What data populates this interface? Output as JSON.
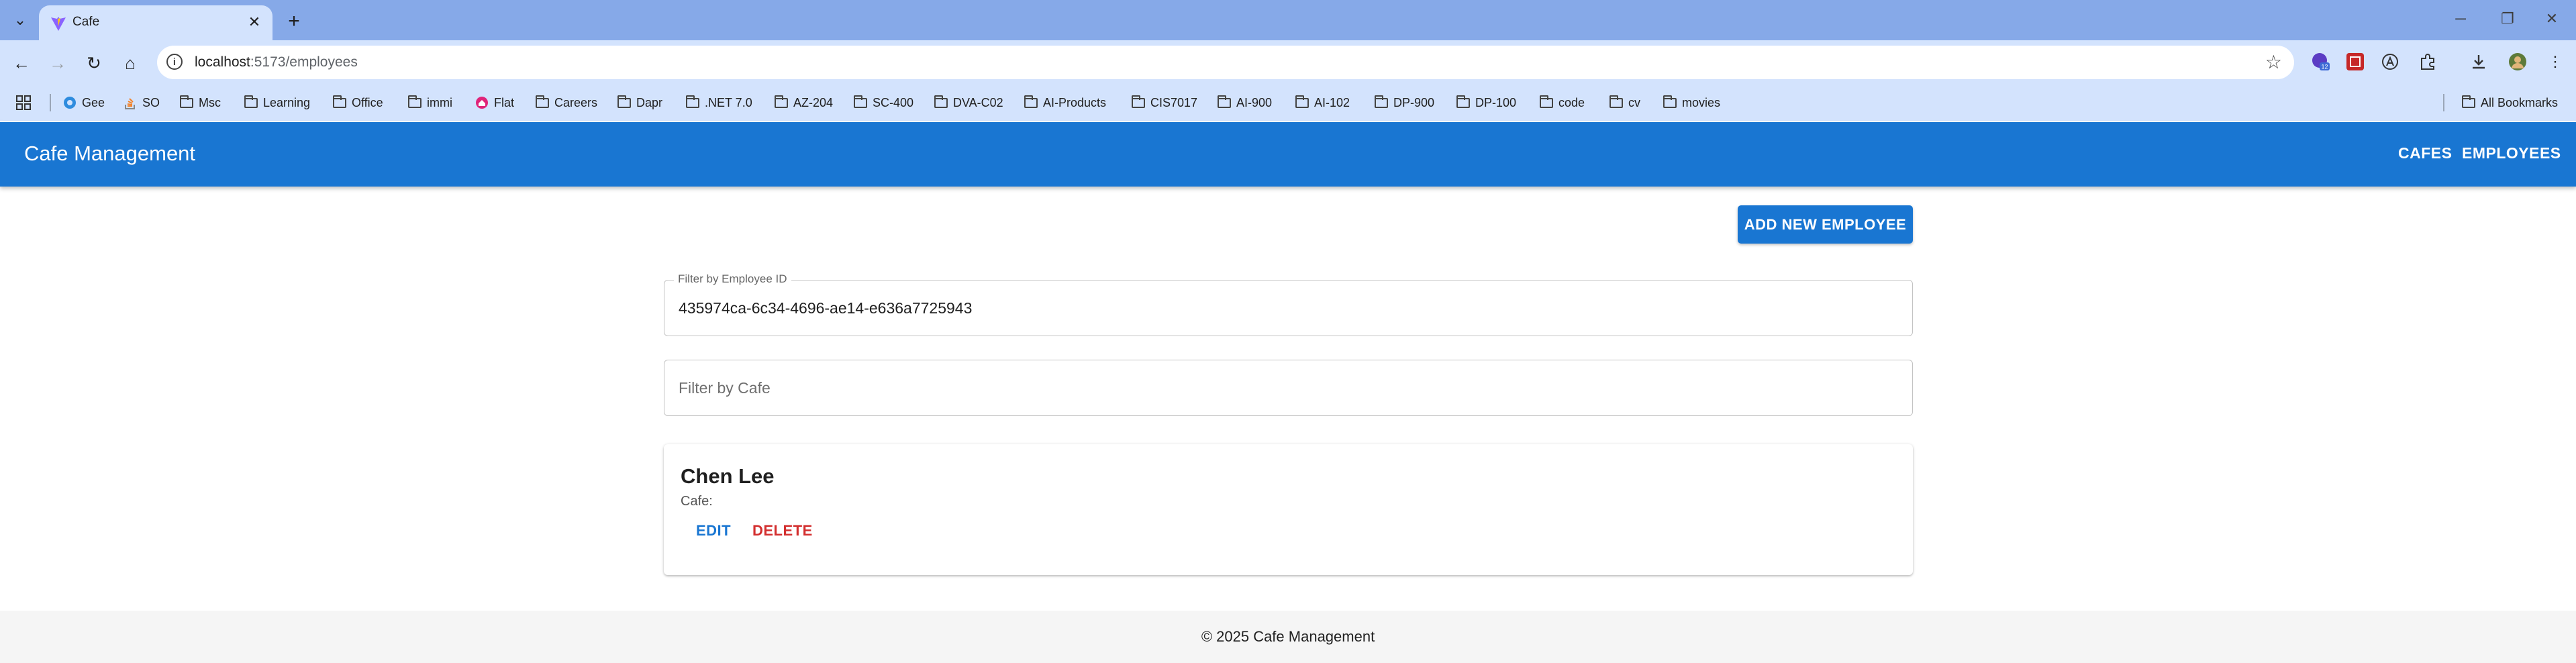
{
  "browser": {
    "tab_title": "Cafe",
    "url_host": "localhost",
    "url_path": ":5173/employees",
    "extension_badge": "12",
    "bookmarks": [
      "Gee",
      "SO",
      "Msc",
      "Learning",
      "Office",
      "immi",
      "Flat",
      "Careers",
      "Dapr",
      ".NET 7.0",
      "AZ-204",
      "SC-400",
      "DVA-C02",
      "AI-Products",
      "CIS7017",
      "AI-900",
      "AI-102",
      "DP-900",
      "DP-100",
      "code",
      "cv",
      "movies"
    ],
    "all_bookmarks_label": "All Bookmarks"
  },
  "app": {
    "title": "Cafe Management",
    "nav": [
      "CAFES",
      "EMPLOYEES"
    ],
    "add_button": "ADD NEW EMPLOYEE",
    "filter_employee": {
      "label": "Filter by Employee ID",
      "value": "435974ca-6c34-4696-ae14-e636a7725943"
    },
    "filter_cafe": {
      "placeholder": "Filter by Cafe"
    },
    "employees": [
      {
        "name": "Chen Lee",
        "cafe_label": "Cafe:",
        "edit": "EDIT",
        "delete": "DELETE"
      }
    ],
    "footer": "© 2025 Cafe Management"
  },
  "colors": {
    "primary": "#1976d2",
    "danger": "#d32f2f",
    "tabstrip": "#86a9e8",
    "toolbar": "#d3e3fd"
  }
}
